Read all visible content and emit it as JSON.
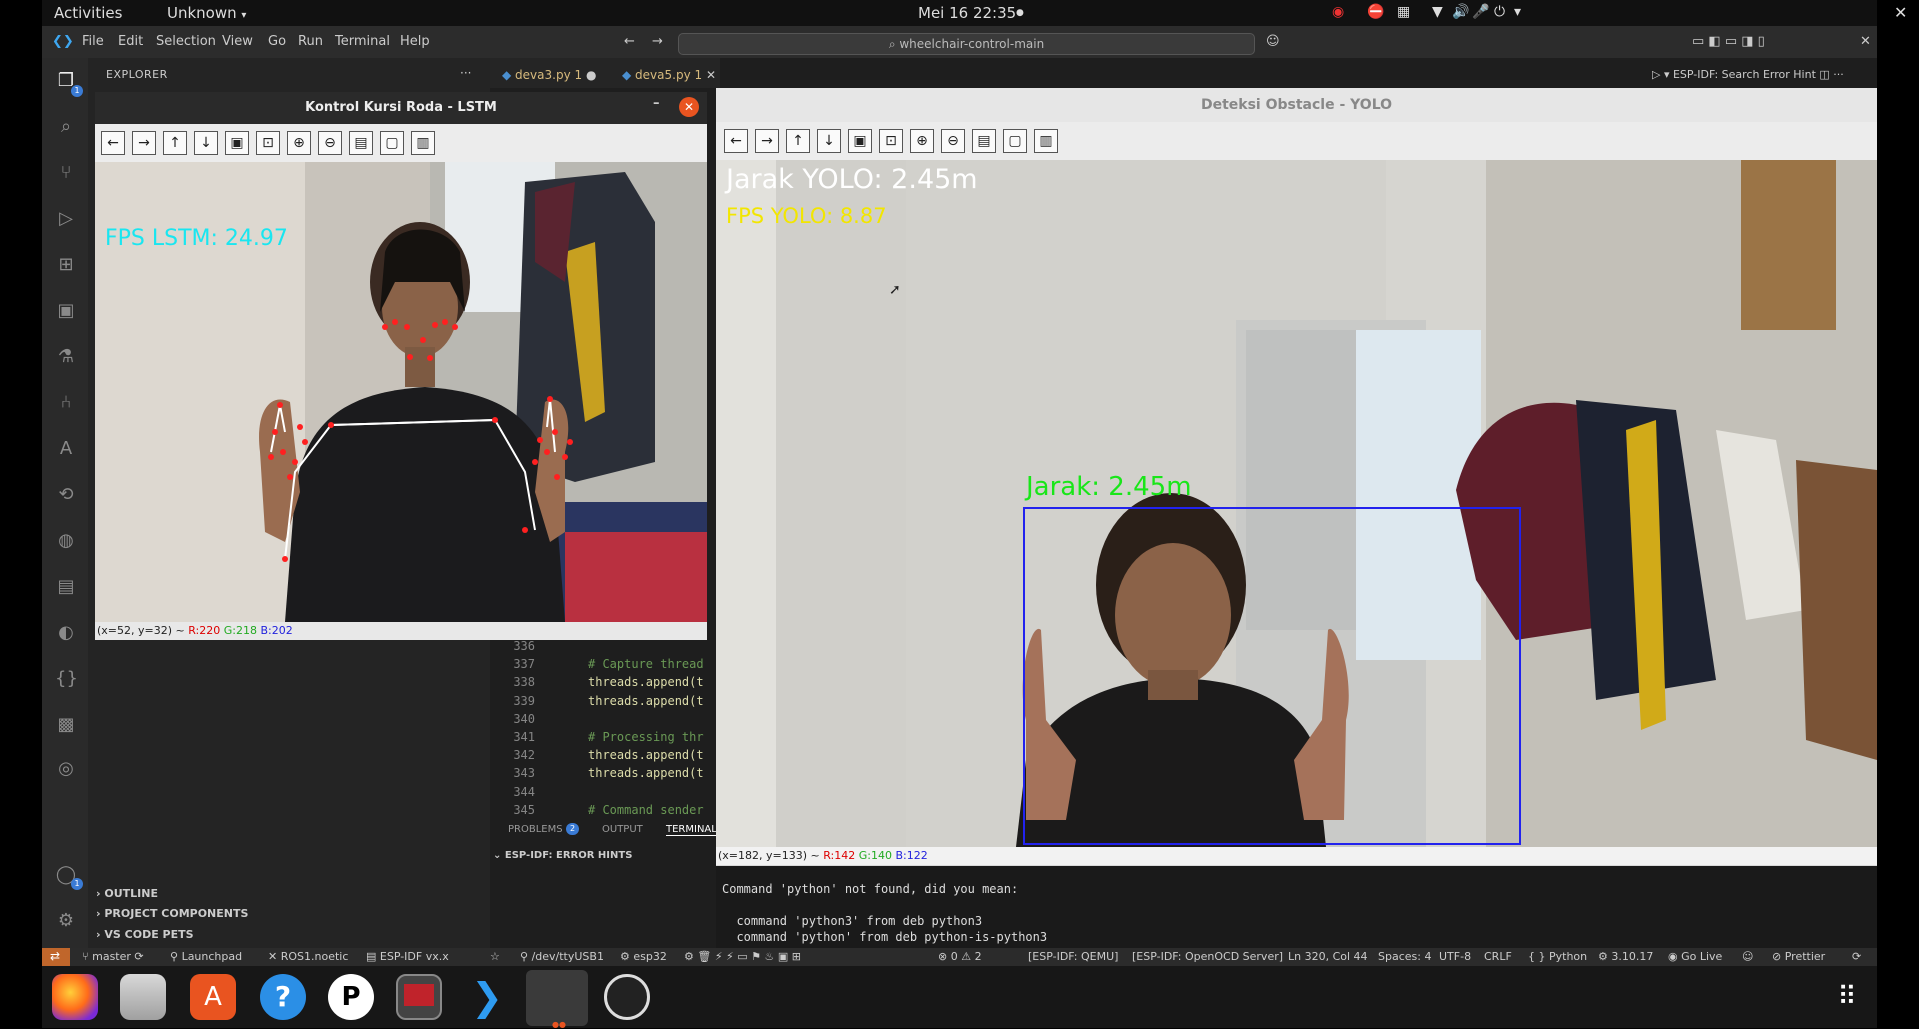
{
  "topbar": {
    "activities": "Activities",
    "app_menu": "Unknown",
    "clock": "Mei 16  22:35"
  },
  "vscode": {
    "menu": [
      "File",
      "Edit",
      "Selection",
      "View",
      "Go",
      "Run",
      "Terminal",
      "Help"
    ],
    "command_center": "wheelchair-control-main",
    "right_toolbar": "ESP-IDF: Search Error Hint",
    "explorer_title": "EXPLORER",
    "tabs": [
      {
        "label": "deva3.py 1"
      },
      {
        "label": "deva5.py 1"
      }
    ],
    "activity_badges": {
      "explorer": "1",
      "accounts": "1"
    },
    "sidebar_sections": [
      "OUTLINE",
      "PROJECT COMPONENTS",
      "VS CODE PETS"
    ],
    "code_lines": [
      {
        "n": "336",
        "text": ""
      },
      {
        "n": "337",
        "text": "# Capture thread"
      },
      {
        "n": "338",
        "text": "threads.append(t"
      },
      {
        "n": "339",
        "text": "threads.append(t"
      },
      {
        "n": "340",
        "text": ""
      },
      {
        "n": "341",
        "text": "# Processing thr"
      },
      {
        "n": "342",
        "text": "threads.append(t"
      },
      {
        "n": "343",
        "text": "threads.append(t"
      },
      {
        "n": "344",
        "text": ""
      },
      {
        "n": "345",
        "text": "# Command sender"
      }
    ],
    "panel_tabs": {
      "problems": "PROBLEMS",
      "problems_count": "2",
      "output": "OUTPUT",
      "terminal": "TERMINAL"
    },
    "esp_hints": "ESP-IDF: ERROR HINTS",
    "terminal_lines": [
      "Command 'python' not found, did you mean:",
      "",
      "  command 'python3' from deb python3",
      "  command 'python' from deb python-is-python3"
    ],
    "statusbar": {
      "branch": "master",
      "launchpad": "Launchpad",
      "ros": "ROS1.noetic",
      "idf": "ESP-IDF vx.x",
      "port": "/dev/ttyUSB1",
      "target": "esp32",
      "errors": "0",
      "warnings": "2",
      "qemu": "[ESP-IDF: QEMU]",
      "openocd": "[ESP-IDF: OpenOCD Server]",
      "position": "Ln 320, Col 44",
      "spaces": "Spaces: 4",
      "encoding": "UTF-8",
      "eol": "CRLF",
      "language": "Python",
      "version": "3.10.17",
      "golive": "Go Live",
      "prettier": "Prettier"
    }
  },
  "lstm_window": {
    "title": "Kontrol Kursi Roda - LSTM",
    "fps_text": "FPS LSTM: 24.97",
    "status_coords": "(x=52, y=32) ~",
    "status_r": "R:220",
    "status_g": "G:218",
    "status_b": "B:202"
  },
  "yolo_window": {
    "title": "Deteksi Obstacle - YOLO",
    "distance_text": "Jarak YOLO: 2.45m",
    "fps_text": "FPS YOLO: 8.87",
    "box_label": "Jarak: 2.45m",
    "status_coords": "(x=182, y=133) ~",
    "status_r": "R:142",
    "status_g": "G:140",
    "status_b": "B:122"
  },
  "colors": {
    "fps_lstm": "#19e6f0",
    "fps_yolo": "#f2e600",
    "box_label": "#19e619",
    "bbox": "#2222ee"
  },
  "dock_apps": [
    "firefox-icon",
    "files-icon",
    "app-center-icon",
    "help-icon",
    "p-app-icon",
    "terminal-app-icon",
    "vscode-icon",
    "active-app-icon",
    "obs-icon",
    "app-grid-icon"
  ]
}
